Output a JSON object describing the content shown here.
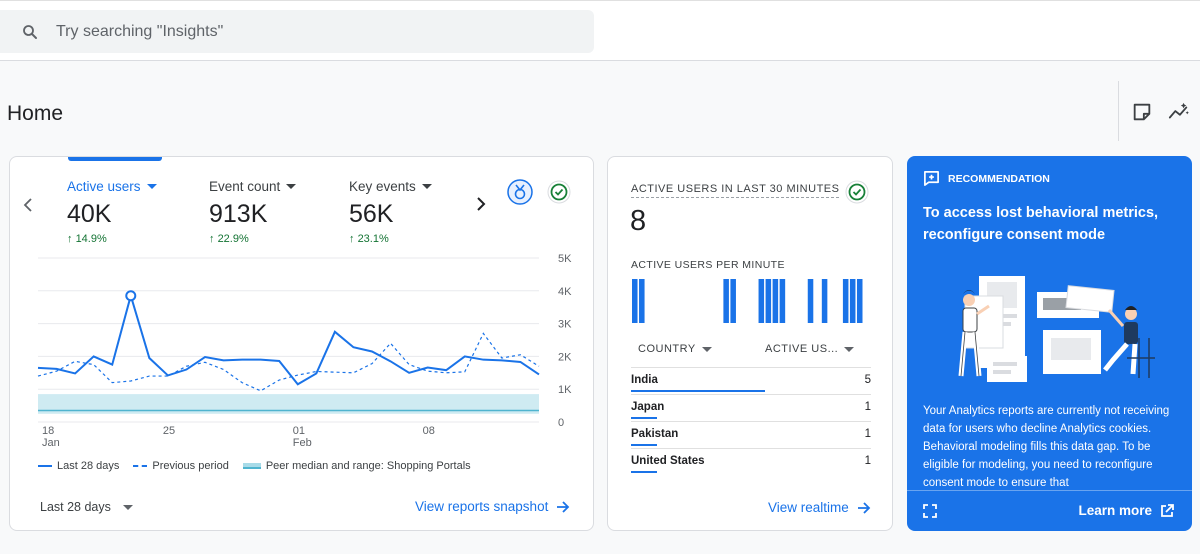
{
  "search": {
    "placeholder": "Try searching \"Insights\""
  },
  "page": {
    "title": "Home"
  },
  "overview": {
    "metrics": [
      {
        "label": "Active users",
        "value": "40K",
        "change": "14.9%"
      },
      {
        "label": "Event count",
        "value": "913K",
        "change": "22.9%"
      },
      {
        "label": "Key events",
        "value": "56K",
        "change": "23.1%"
      }
    ],
    "legend": [
      "Last 28 days",
      "Previous period",
      "Peer median and range: Shopping Portals"
    ],
    "date_range": "Last 28 days",
    "link": "View reports snapshot"
  },
  "chart_data": {
    "type": "line",
    "x_ticks": [
      {
        "day": "18",
        "month": "Jan"
      },
      {
        "day": "25",
        "month": ""
      },
      {
        "day": "01",
        "month": "Feb"
      },
      {
        "day": "08",
        "month": ""
      }
    ],
    "y_ticks": [
      "5K",
      "4K",
      "3K",
      "2K",
      "1K",
      "0"
    ],
    "ylim": [
      0,
      5000
    ],
    "series": [
      {
        "name": "Last 28 days",
        "style": "solid",
        "values": [
          1650,
          1620,
          1480,
          2000,
          1750,
          3850,
          1950,
          1420,
          1600,
          1980,
          1880,
          1900,
          1900,
          1860,
          1150,
          1480,
          2750,
          2280,
          2150,
          1850,
          1500,
          1660,
          1580,
          2000,
          1900,
          1880,
          1830,
          1450
        ]
      },
      {
        "name": "Previous period",
        "style": "dashed",
        "values": [
          1400,
          1550,
          1850,
          1750,
          1200,
          1250,
          1400,
          1400,
          1700,
          1820,
          1600,
          1200,
          950,
          1280,
          1430,
          1540,
          1520,
          1500,
          1780,
          2400,
          1750,
          1550,
          1500,
          1530,
          2700,
          1950,
          2050,
          1700
        ]
      },
      {
        "name": "Peer median and range: Shopping Portals",
        "style": "band",
        "median": 350,
        "lower": 250,
        "upper": 850
      }
    ],
    "colors": {
      "primary": "#1a73e8",
      "band": "#a8dbe8"
    }
  },
  "realtime": {
    "title": "ACTIVE USERS IN LAST 30 MINUTES",
    "value": "8",
    "subtitle": "ACTIVE USERS PER MINUTE",
    "per_minute": [
      1,
      1,
      0,
      0,
      0,
      0,
      0,
      0,
      0,
      0,
      0,
      0,
      0,
      1,
      1,
      0,
      0,
      0,
      1,
      1,
      1,
      1,
      0,
      0,
      0,
      1,
      0,
      1,
      0,
      0,
      1,
      1,
      1
    ],
    "columns": [
      "COUNTRY",
      "ACTIVE US..."
    ],
    "rows": [
      {
        "country": "India",
        "users": "5",
        "share": 0.56
      },
      {
        "country": "Japan",
        "users": "1",
        "share": 0.11
      },
      {
        "country": "Pakistan",
        "users": "1",
        "share": 0.11
      },
      {
        "country": "United States",
        "users": "1",
        "share": 0.11
      }
    ],
    "link": "View realtime"
  },
  "recommendation": {
    "tag": "RECOMMENDATION",
    "title": "To access lost behavioral metrics, reconfigure consent mode",
    "body": "Your Analytics reports are currently not receiving data for users who decline Analytics cookies. Behavioral modeling fills this data gap. To be eligible for modeling, you need to reconfigure consent mode to ensure that",
    "link": "Learn more"
  },
  "colors": {
    "accent": "#1a73e8",
    "positive": "#137333",
    "success": "#188038"
  }
}
